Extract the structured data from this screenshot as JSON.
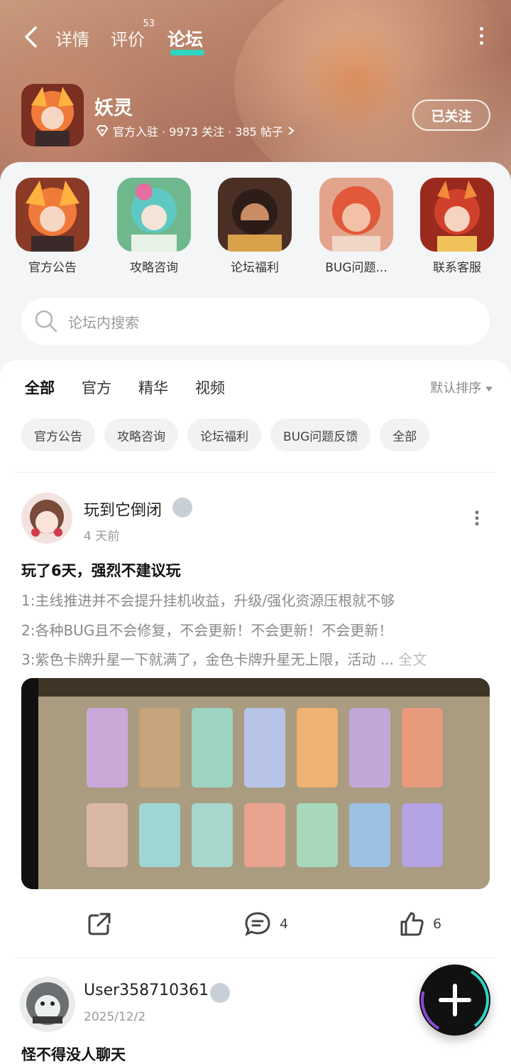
{
  "topbar": {
    "tabs": [
      {
        "label": "详情"
      },
      {
        "label": "评价",
        "badge": "53"
      },
      {
        "label": "论坛"
      }
    ]
  },
  "game": {
    "name": "妖灵",
    "meta": "官方入驻 · 9973 关注 · 385 帖子",
    "follow_label": "已关注"
  },
  "shortcuts": [
    {
      "label": "官方公告"
    },
    {
      "label": "攻略咨询"
    },
    {
      "label": "论坛福利"
    },
    {
      "label": "BUG问题..."
    },
    {
      "label": "联系客服"
    }
  ],
  "search": {
    "placeholder": "论坛内搜索"
  },
  "feed_tabs": [
    {
      "label": "全部"
    },
    {
      "label": "官方"
    },
    {
      "label": "精华"
    },
    {
      "label": "视频"
    }
  ],
  "sort_label": "默认排序",
  "chips": [
    {
      "label": "官方公告"
    },
    {
      "label": "攻略咨询"
    },
    {
      "label": "论坛福利"
    },
    {
      "label": "BUG问题反馈"
    },
    {
      "label": "全部"
    }
  ],
  "posts": [
    {
      "user": "玩到它倒闭",
      "time": "4 天前",
      "title": "玩了6天，强烈不建议玩",
      "lines": [
        "1:主线推进并不会提升挂机收益，升级/强化资源压根就不够",
        "2:各种BUG且不会修复，不会更新！不会更新！不会更新！",
        "3:紫色卡牌升星一下就满了，金色卡牌升星无上限，活动 ..."
      ],
      "fulltext_label": "全文",
      "comments": "4",
      "likes": "6"
    },
    {
      "user": "User358710361",
      "time": "2025/12/2",
      "title": "怪不得没人聊天"
    }
  ],
  "colors": {
    "accent": "#2fd6c2"
  }
}
